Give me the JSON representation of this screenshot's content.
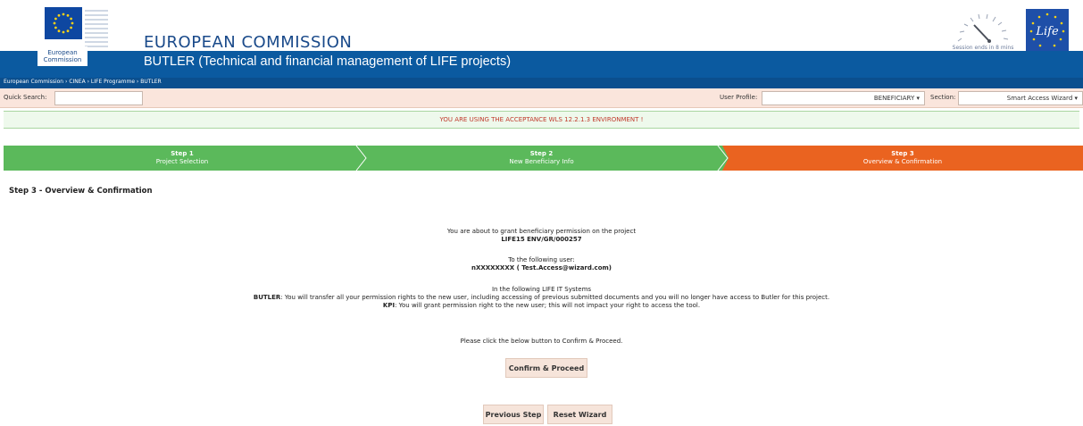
{
  "header": {
    "org_title": "EUROPEAN COMMISSION",
    "org_caption_line1": "European",
    "org_caption_line2": "Commission",
    "app_title": "BUTLER (Technical and financial management of LIFE projects)",
    "session_text": "Session ends in 8 mins",
    "life_logo_text": "Life"
  },
  "breadcrumb": {
    "items": [
      "European Commission",
      "CINEA",
      "LIFE Programme",
      "BUTLER"
    ]
  },
  "toolbar": {
    "quick_search_label": "Quick Search:",
    "quick_search_value": "",
    "user_profile_label": "User Profile:",
    "user_profile_value": "BENEFICIARY ▾",
    "section_label": "Section:",
    "section_value": "Smart Access Wizard ▾"
  },
  "warning": "YOU ARE USING THE ACCEPTANCE WLS 12.2.1.3 ENVIRONMENT !",
  "steps": [
    {
      "num": "Step 1",
      "label": "Project Selection"
    },
    {
      "num": "Step 2",
      "label": "New Beneficiary Info"
    },
    {
      "num": "Step 3",
      "label": "Overview & Confirmation"
    }
  ],
  "colors": {
    "step_done": "#5bb95b",
    "step_active": "#ea6320",
    "banner": "#0b5aa0"
  },
  "page_title": "Step 3 - Overview & Confirmation",
  "content": {
    "grant_intro": "You are about to grant beneficiary permission on the project",
    "project_code": "LIFE15 ENV/GR/000257",
    "user_intro": "To the following user:",
    "user_value": "nXXXXXXXX ( Test.Access@wizard.com)",
    "systems_intro": "In the following LIFE IT Systems",
    "butler_label": "BUTLER",
    "butler_text": ": You will transfer all your permission rights to the new user, including accessing of previous submitted documents and you will no longer have access to Butler for this project.",
    "kpi_label": "KPI",
    "kpi_text": ": You will grant permission right to the new user; this will not impact your right to access the tool.",
    "click_text": "Please click the below button to Confirm & Proceed."
  },
  "buttons": {
    "confirm": "Confirm & Proceed",
    "previous": "Previous Step",
    "reset": "Reset Wizard"
  }
}
